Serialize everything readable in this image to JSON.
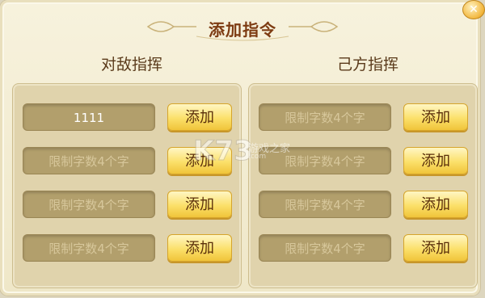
{
  "dialog": {
    "title": "添加指令",
    "close_icon": "close-icon"
  },
  "columns": [
    {
      "heading": "对敌指挥",
      "rows": [
        {
          "value": "1111",
          "placeholder": "",
          "button": "添加"
        },
        {
          "value": "",
          "placeholder": "限制字数4个字",
          "button": "添加"
        },
        {
          "value": "",
          "placeholder": "限制字数4个字",
          "button": "添加"
        },
        {
          "value": "",
          "placeholder": "限制字数4个字",
          "button": "添加"
        }
      ]
    },
    {
      "heading": "己方指挥",
      "rows": [
        {
          "value": "",
          "placeholder": "限制字数4个字",
          "button": "添加"
        },
        {
          "value": "",
          "placeholder": "限制字数4个字",
          "button": "添加"
        },
        {
          "value": "",
          "placeholder": "限制字数4个字",
          "button": "添加"
        },
        {
          "value": "",
          "placeholder": "限制字数4个字",
          "button": "添加"
        }
      ]
    }
  ],
  "watermark": {
    "logo": "K73",
    "tagline": "游戏之家",
    "url": ".com"
  }
}
